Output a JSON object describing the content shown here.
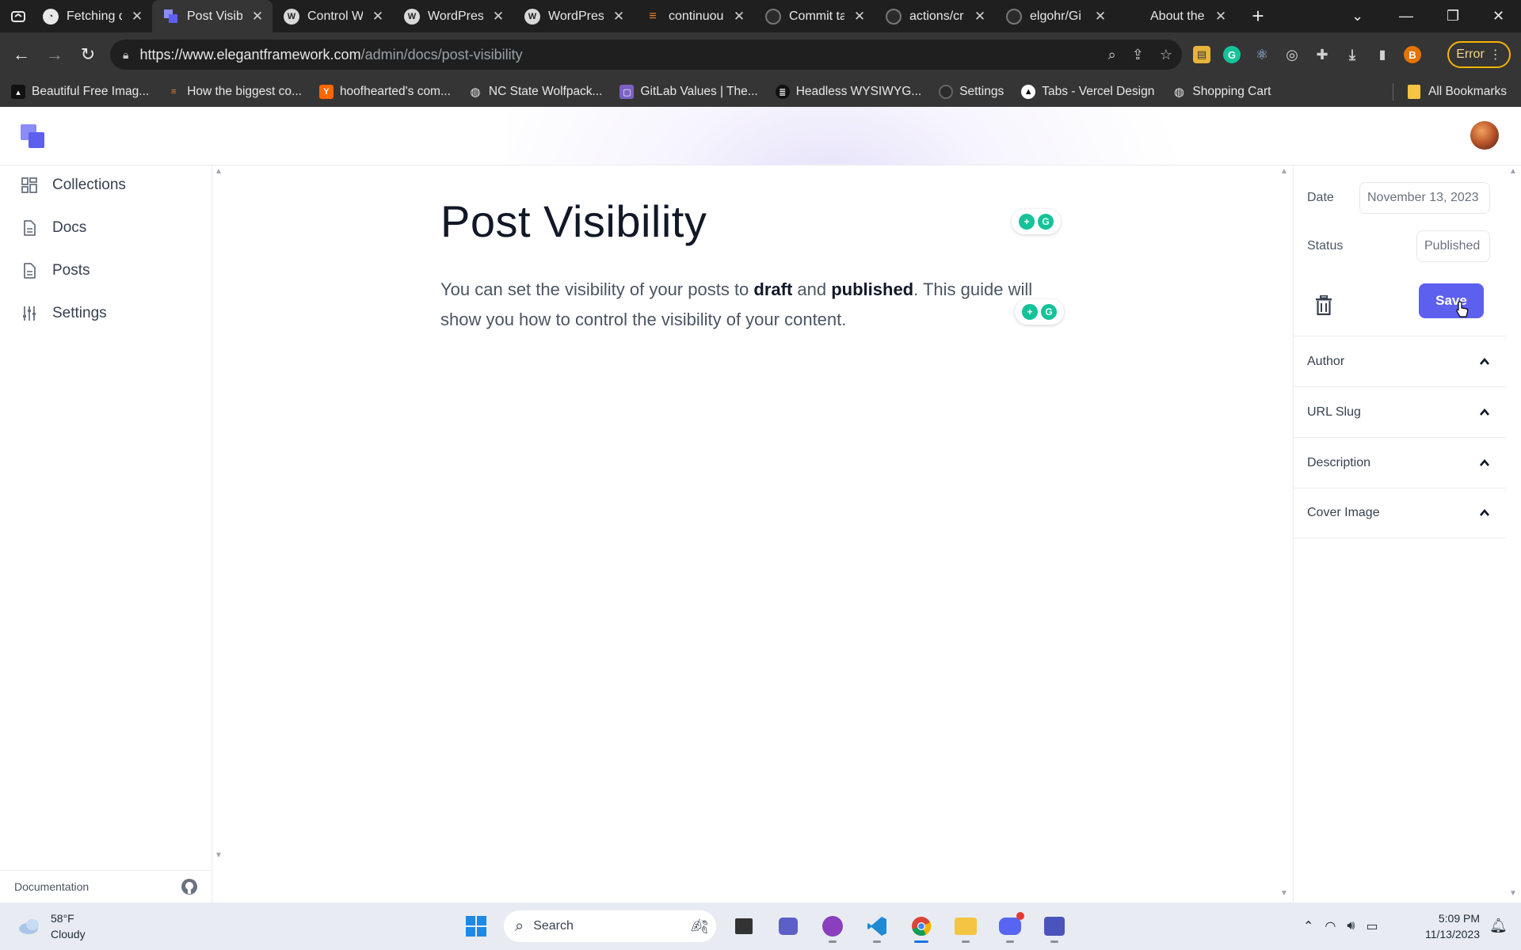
{
  "browser": {
    "tabs": [
      {
        "label": "Fetching d",
        "icon": "loading-icon"
      },
      {
        "label": "Post Visibi",
        "icon": "app-logo-icon",
        "active": true
      },
      {
        "label": "Control W",
        "icon": "wordpress-icon"
      },
      {
        "label": "WordPres",
        "icon": "wordpress-icon"
      },
      {
        "label": "WordPres",
        "icon": "wordpress-icon"
      },
      {
        "label": "continuou",
        "icon": "stackoverflow-icon"
      },
      {
        "label": "Commit ta",
        "icon": "github-icon"
      },
      {
        "label": "actions/cr",
        "icon": "github-icon"
      },
      {
        "label": "elgohr/Gi",
        "icon": "github-icon"
      },
      {
        "label": "About the",
        "icon": "blank-icon"
      }
    ],
    "url_host": "https://www.elegantframework.com",
    "url_path": "/admin/docs/post-visibility",
    "profile_initial": "B",
    "error_label": "Error",
    "bookmarks": [
      "Beautiful Free Imag...",
      "How the biggest co...",
      "hoofhearted's com...",
      "NC State Wolfpack...",
      "GitLab Values | The...",
      "Headless WYSIWYG...",
      "Settings",
      "Tabs - Vercel Design",
      "Shopping Cart"
    ],
    "all_bookmarks": "All Bookmarks"
  },
  "sidebar": {
    "items": [
      {
        "label": "Collections",
        "icon": "collections-icon"
      },
      {
        "label": "Docs",
        "icon": "document-icon"
      },
      {
        "label": "Posts",
        "icon": "document-icon"
      },
      {
        "label": "Settings",
        "icon": "sliders-icon"
      }
    ],
    "footer_link": "Documentation"
  },
  "editor": {
    "title": "Post Visibility",
    "body_1": "You can set the visibility of your posts to ",
    "body_bold_1": "draft",
    "body_2": " and ",
    "body_bold_2": "published",
    "body_3": ". This guide will show you how to control the visibility of your content."
  },
  "panel": {
    "date_label": "Date",
    "date_value": "November 13, 2023",
    "status_label": "Status",
    "status_value": "Published",
    "save_label": "Save",
    "sections": [
      "Author",
      "URL Slug",
      "Description",
      "Cover Image"
    ]
  },
  "taskbar": {
    "temperature": "58°F",
    "weather": "Cloudy",
    "search_label": "Search",
    "time": "5:09 PM",
    "date": "11/13/2023"
  },
  "colors": {
    "accent": "#5d5fef",
    "browser_dark": "#1f1f1f",
    "browser_mid": "#353535"
  }
}
